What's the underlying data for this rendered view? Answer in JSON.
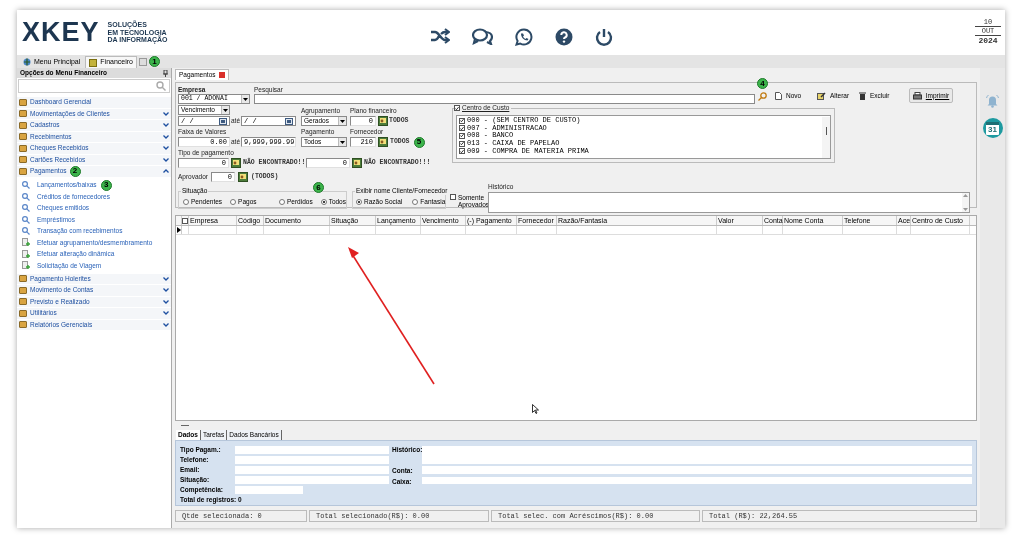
{
  "header": {
    "logo": "XKEY",
    "tagline": [
      "SOLUÇÕES",
      "EM TECNOLOGIA",
      "DA INFORMAÇÃO"
    ],
    "date": {
      "day": "10",
      "month": "OUT",
      "year": "2024"
    }
  },
  "module_tabs": [
    {
      "label": "Menu Principal",
      "selected": false,
      "closable": false
    },
    {
      "label": "Financeiro",
      "selected": true,
      "closable": true,
      "marker": "1"
    }
  ],
  "sidebar": {
    "title": "Opções do Menu Financeiro",
    "sections": [
      {
        "label": "Dashboard Gerencial",
        "kind": "link"
      },
      {
        "label": "Movimentações de Clientes",
        "kind": "group",
        "expanded": false
      },
      {
        "label": "Cadastros",
        "kind": "group",
        "expanded": false
      },
      {
        "label": "Recebimentos",
        "kind": "group",
        "expanded": false
      },
      {
        "label": "Cheques Recebidos",
        "kind": "group",
        "expanded": false
      },
      {
        "label": "Cartões Recebidos",
        "kind": "group",
        "expanded": false
      },
      {
        "label": "Pagamentos",
        "kind": "group",
        "expanded": true,
        "marker": "2",
        "children": [
          {
            "label": "Lançamentos/baixas",
            "kind": "search",
            "marker": "3"
          },
          {
            "label": "Créditos de fornecedores",
            "kind": "search"
          },
          {
            "label": "Cheques emitidos",
            "kind": "search"
          },
          {
            "label": "Empréstimos",
            "kind": "search"
          },
          {
            "label": "Transação com recebimentos",
            "kind": "search"
          },
          {
            "label": "Efetuar agrupamento/desmembramento",
            "kind": "action"
          },
          {
            "label": "Efetuar alteração dinâmica",
            "kind": "action"
          },
          {
            "label": "Solicitação de Viagem",
            "kind": "action"
          }
        ]
      },
      {
        "label": "Pagamento Holerites",
        "kind": "group",
        "expanded": false
      },
      {
        "label": "Movimento de Contas",
        "kind": "group",
        "expanded": false
      },
      {
        "label": "Previsto e Realizado",
        "kind": "group",
        "expanded": false
      },
      {
        "label": "Utilitários",
        "kind": "group",
        "expanded": false
      },
      {
        "label": "Relatórios Gerenciais",
        "kind": "group",
        "expanded": false
      }
    ]
  },
  "document_tab": {
    "label": "Pagamentos",
    "selected": true
  },
  "form": {
    "empresa": {
      "label": "Empresa",
      "value": "001 / ADONAI"
    },
    "pesquisar": {
      "label": "Pesquisar",
      "marker": "4"
    },
    "toolbar": [
      {
        "label": "Novo",
        "kind": "new"
      },
      {
        "label": "Alterar",
        "kind": "edit"
      },
      {
        "label": "Excluir",
        "kind": "delete"
      },
      {
        "label": "Imprimir",
        "kind": "print"
      }
    ],
    "vencimento": {
      "value": "Vencimento",
      "from": "/  /",
      "until": "até",
      "to": "/  /"
    },
    "agrupamento": {
      "label": "Agrupamento",
      "value": "Gerados"
    },
    "plano": {
      "label": "Plano financeiro",
      "value": "0",
      "name": "TODOS"
    },
    "faixa": {
      "label": "Faixa de Valores",
      "from": "0.00",
      "until": "até",
      "to": "9,999,999.99"
    },
    "pagamento": {
      "label": "Pagamento",
      "value": "Todos"
    },
    "fornecedor": {
      "label": "Fornecedor",
      "value": "210",
      "name": "TODOS",
      "marker": "5"
    },
    "tipo_pagamento": {
      "label": "Tipo de pagamento",
      "items": [
        {
          "value": "0",
          "name": "NÃO ENCONTRADO!!"
        },
        {
          "value": "0",
          "name": "NÃO ENCONTRADO!!!"
        }
      ]
    },
    "aprovador": {
      "label": "Aprovador",
      "value": "0",
      "name": "(TODOS)"
    },
    "situacao": {
      "label": "Situação",
      "marker": "6",
      "options": [
        {
          "label": "Pendentes",
          "selected": false
        },
        {
          "label": "Pagos",
          "selected": false
        },
        {
          "label": "Perdidos",
          "selected": false
        },
        {
          "label": "Todos",
          "selected": true
        }
      ]
    },
    "exibir_nome": {
      "label": "Exibir nome Cliente/Fornecedor",
      "options": [
        {
          "label": "Razão Social",
          "selected": true
        },
        {
          "label": "Fantasia",
          "selected": false
        }
      ]
    },
    "somente_aprovados": {
      "label": "Somente Aprovados",
      "checked": false
    },
    "historico": {
      "label": "Histórico"
    },
    "centro_custo": {
      "label": "Centro de Custo",
      "checked": true,
      "items": [
        {
          "label": "000 - (SEM CENTRO DE CUSTO)",
          "checked": true
        },
        {
          "label": "007 - ADMINISTRACAO",
          "checked": true
        },
        {
          "label": "008 - BANCO",
          "checked": true
        },
        {
          "label": "013 - CAIXA DE PAPELAO",
          "checked": true
        },
        {
          "label": "009 - COMPRA DE MATERIA PRIMA",
          "checked": true
        }
      ]
    }
  },
  "table": {
    "select_all_checked": false,
    "columns": [
      "Empresa",
      "Código",
      "Documento",
      "Situação",
      "Lançamento",
      "Vencimento",
      "(-) Pagamento",
      "Fornecedor",
      "Razão/Fantasia",
      "Valor",
      "Conta",
      "Nome Conta",
      "Telefone",
      "Ace",
      "Centro de Custo"
    ]
  },
  "detail": {
    "tabs": [
      {
        "label": "Dados",
        "selected": true
      },
      {
        "label": "Tarefas",
        "selected": false
      },
      {
        "label": "Dados Bancários",
        "selected": false
      }
    ],
    "left_fields": [
      {
        "label": "Tipo Pagam.:",
        "kind": "wide"
      },
      {
        "label": "Telefone:",
        "kind": "wide"
      },
      {
        "label": "Email:",
        "kind": "wide"
      },
      {
        "label": "Situação:",
        "kind": "wide"
      },
      {
        "label": "Competência:",
        "kind": "short"
      }
    ],
    "right_fields": [
      {
        "label": "Histórico:",
        "kind": "tall"
      },
      {
        "label": "Conta:",
        "kind": "line"
      },
      {
        "label": "Caixa:",
        "kind": "line"
      }
    ],
    "total": "Total de registros: 0"
  },
  "status_bar": [
    "Qtde selecionada: 0",
    "Total selecionado(R$): 0.00",
    "Total selec. com Acréscimos(R$): 0.00",
    "Total (R$): 22,264.55"
  ],
  "side_tools": {
    "calendar_day": "31"
  }
}
